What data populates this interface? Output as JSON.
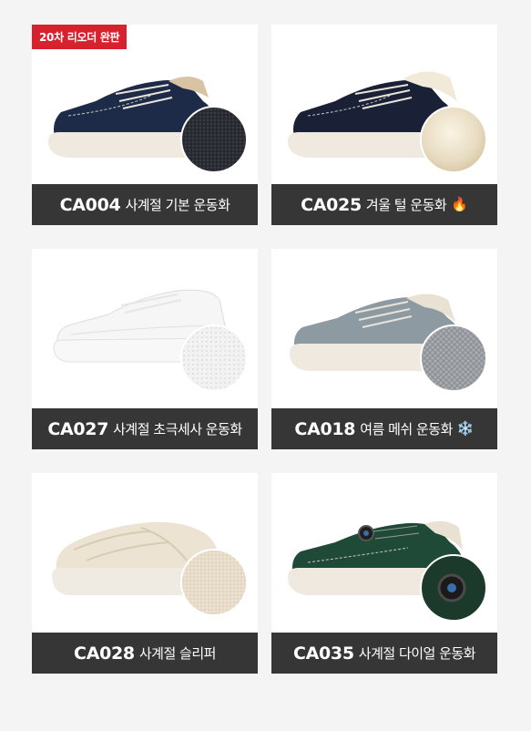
{
  "badge": {
    "text": "20차 리오더 완판"
  },
  "products": [
    {
      "code": "CA004",
      "name": "사계절 기본 운동화",
      "emoji": "",
      "upper_color": "#1d2a48",
      "swatch": "navy-suede-texture"
    },
    {
      "code": "CA025",
      "name": "겨울 털 운동화",
      "emoji": "🔥",
      "upper_color": "#1a2136",
      "swatch": "cream-fur-texture"
    },
    {
      "code": "CA027",
      "name": "사계절 초극세사 운동화",
      "emoji": "",
      "upper_color": "#f6f6f6",
      "swatch": "white-leather-texture"
    },
    {
      "code": "CA018",
      "name": "여름 메쉬 운동화",
      "emoji": "❄️",
      "upper_color": "#8e9aa2",
      "swatch": "grey-mesh-texture"
    },
    {
      "code": "CA028",
      "name": "사계절 슬리퍼",
      "emoji": "",
      "upper_color": "#ece3d2",
      "swatch": "canvas-texture"
    },
    {
      "code": "CA035",
      "name": "사계절 다이얼 운동화",
      "emoji": "",
      "upper_color": "#1f4a38",
      "swatch": "dial-closure-closeup"
    }
  ],
  "colors": {
    "label_bg": "#363636",
    "badge_bg": "#d8212f",
    "sole": "#efe9df",
    "page_bg": "#f4f4f4"
  }
}
